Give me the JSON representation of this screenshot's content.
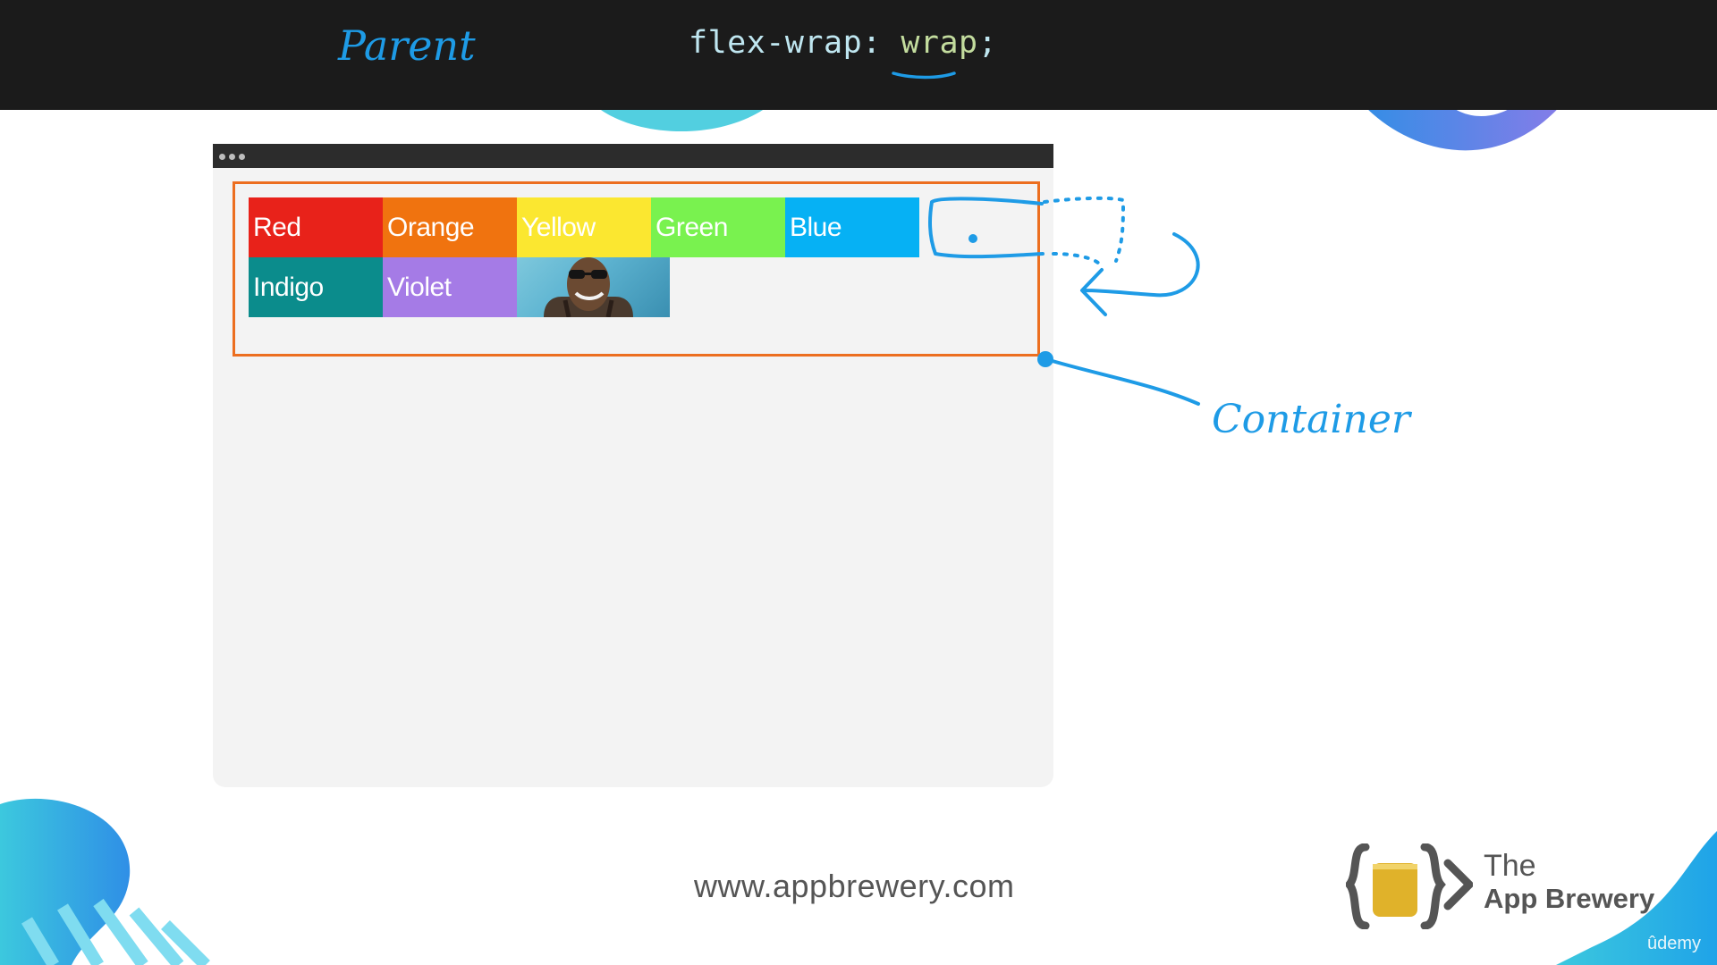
{
  "header": {
    "annotation": "Parent",
    "code_property": "flex-wrap",
    "code_colon": ": ",
    "code_value": "wrap",
    "code_semicolon": ";"
  },
  "browser": {
    "items": [
      {
        "label": "Red",
        "color": "#e8221a"
      },
      {
        "label": "Orange",
        "color": "#f0730f"
      },
      {
        "label": "Yellow",
        "color": "#fbe730"
      },
      {
        "label": "Green",
        "color": "#79f24f"
      },
      {
        "label": "Blue",
        "color": "#06b1f4"
      },
      {
        "label": "Indigo",
        "color": "#0b8c8c"
      },
      {
        "label": "Violet",
        "color": "#a57be6"
      }
    ],
    "image_icon": "person-photo-icon"
  },
  "annotations": {
    "container_label": "Container"
  },
  "footer": {
    "url": "www.appbrewery.com",
    "logo_the": "The",
    "logo_name": "App Brewery",
    "platform": "ûdemy"
  },
  "colors": {
    "accent_blue": "#1e9be6",
    "container_border": "#ec6e1f",
    "topbar": "#1b1b1b"
  }
}
